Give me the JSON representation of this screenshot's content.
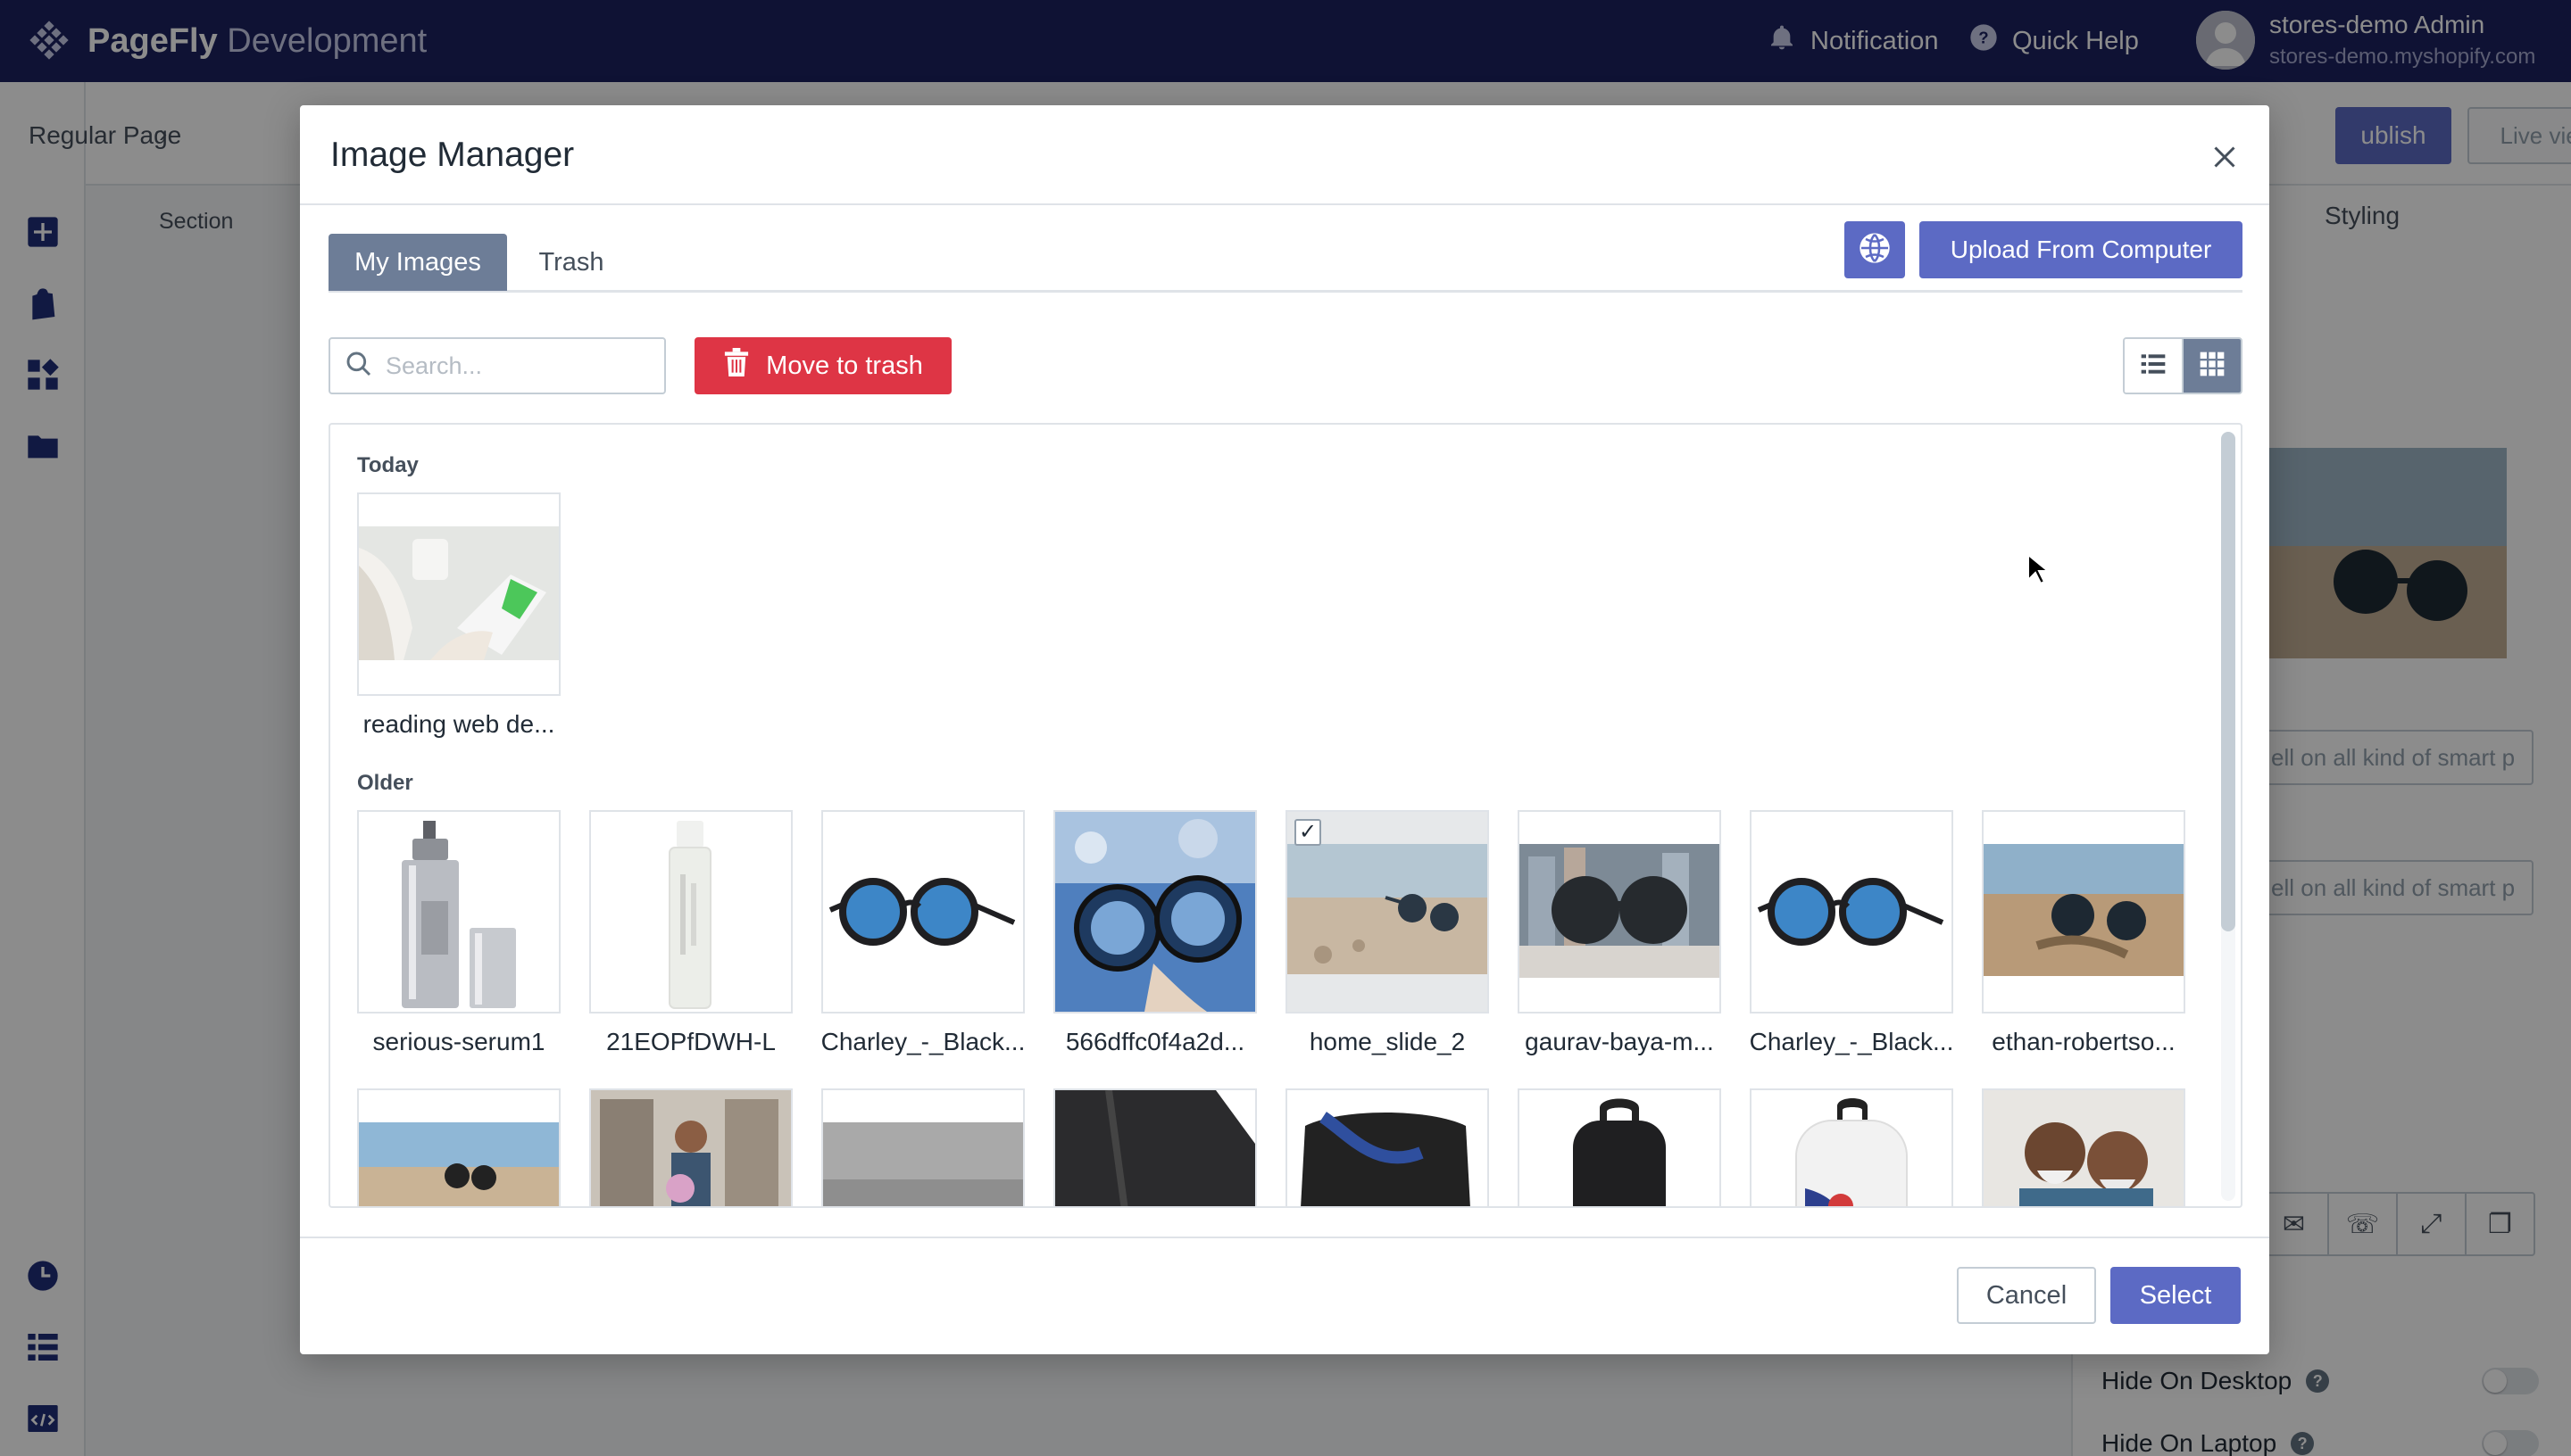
{
  "topbar": {
    "brand_bold": "PageFly",
    "brand_light": "Development",
    "notification_label": "Notification",
    "help_label": "Quick Help",
    "user_name": "stores-demo Admin",
    "user_store": "stores-demo.myshopify.com"
  },
  "editor": {
    "breadcrumb_page": "Regular Page",
    "breadcrumb_section": "Section",
    "publish_label": "ublish",
    "live_view_label": "Live view",
    "styling_tab": "Styling",
    "field_placeholder": "ell on all kind of smart p",
    "toggles": [
      "Hide On Desktop",
      "Hide On Laptop"
    ]
  },
  "modal": {
    "title": "Image Manager",
    "tabs": [
      "My Images",
      "Trash"
    ],
    "upload_label": "Upload From Computer",
    "search_placeholder": "Search...",
    "move_to_trash_label": "Move to trash",
    "groups": {
      "today": "Today",
      "older": "Older"
    },
    "today_images": [
      {
        "name": "reading web de...",
        "icon": "phone-reading-photo"
      }
    ],
    "older_images": [
      {
        "name": "serious-serum1",
        "icon": "serum-bottle-photo",
        "selected": false
      },
      {
        "name": "21EOPfDWH-L",
        "icon": "serum-tube-photo",
        "selected": false
      },
      {
        "name": "Charley_-_Black...",
        "icon": "sunglasses-photo",
        "selected": false
      },
      {
        "name": "566dffc0f4a2d...",
        "icon": "sunglasses-reflection-photo",
        "selected": false
      },
      {
        "name": "home_slide_2",
        "icon": "beach-sunglasses-photo",
        "selected": true
      },
      {
        "name": "gaurav-baya-m...",
        "icon": "city-sunglasses-photo",
        "selected": false
      },
      {
        "name": "Charley_-_Black...",
        "icon": "sunglasses-photo",
        "selected": false
      },
      {
        "name": "ethan-robertso...",
        "icon": "sand-sunglasses-photo",
        "selected": false
      }
    ],
    "cancel_label": "Cancel",
    "select_label": "Select"
  },
  "colors": {
    "topbar": "#1c2260",
    "primary": "#5c6ac4",
    "danger": "#de3545",
    "tab_active": "#6d7d97"
  }
}
